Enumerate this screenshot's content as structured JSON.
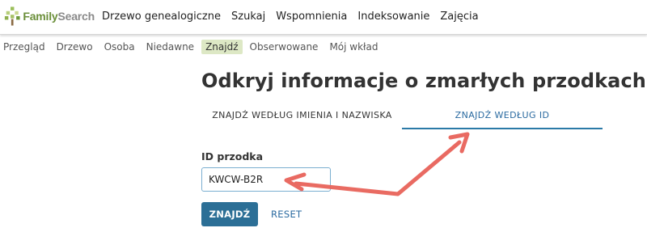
{
  "logo": {
    "family": "Family",
    "search": "Search"
  },
  "topnav": {
    "items": [
      {
        "label": "Drzewo genealogiczne"
      },
      {
        "label": "Szukaj"
      },
      {
        "label": "Wspomnienia"
      },
      {
        "label": "Indeksowanie"
      },
      {
        "label": "Zajęcia"
      }
    ]
  },
  "subnav": {
    "items": [
      {
        "label": "Przegląd"
      },
      {
        "label": "Drzewo"
      },
      {
        "label": "Osoba"
      },
      {
        "label": "Niedawne"
      },
      {
        "label": "Znajdź",
        "active": true
      },
      {
        "label": "Obserwowane"
      },
      {
        "label": "Mój wkład"
      }
    ]
  },
  "main": {
    "title": "Odkryj informacje o zmarłych przodkach",
    "tabs": [
      {
        "label": "ZNAJDŹ WEDŁUG IMIENIA I NAZWISKA",
        "selected": false
      },
      {
        "label": "ZNAJDŹ WEDŁUG ID",
        "selected": true
      }
    ],
    "form": {
      "id_label": "ID przodka",
      "id_value": "KWCW-B2R",
      "find_button": "ZNAJDŹ",
      "reset_link": "RESET"
    }
  },
  "colors": {
    "accent_blue": "#2c6f96",
    "active_subnav_bg": "#dde8c5",
    "annotation_arrow": "#e8635a",
    "logo_green": "#6b8f3a"
  },
  "icons": {
    "logo": "familysearch-tree-icon",
    "annotation": "red-arrow-annotation"
  }
}
